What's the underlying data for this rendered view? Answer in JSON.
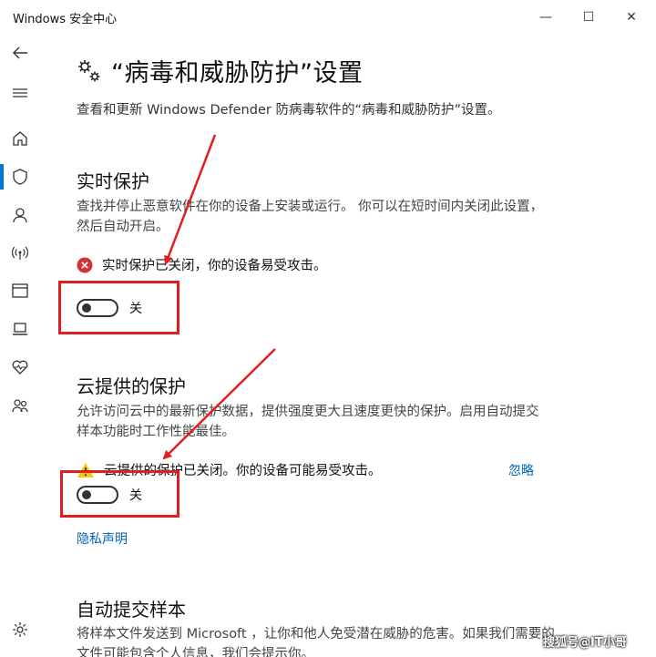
{
  "window": {
    "title": "Windows 安全中心",
    "minimize_glyph": "—",
    "maximize_glyph": "☐",
    "close_glyph": "✕"
  },
  "sidebar": {
    "items": [
      {
        "icon": "back-arrow-icon"
      },
      {
        "icon": "hamburger-menu-icon"
      },
      {
        "icon": "home-icon"
      },
      {
        "icon": "shield-icon",
        "active": true
      },
      {
        "icon": "person-icon"
      },
      {
        "icon": "wifi-antenna-icon"
      },
      {
        "icon": "browser-window-icon"
      },
      {
        "icon": "laptop-icon"
      },
      {
        "icon": "heart-pulse-icon"
      },
      {
        "icon": "family-icon"
      },
      {
        "icon": "gear-icon"
      }
    ],
    "accent_color": "#0078d7"
  },
  "page": {
    "title": "“病毒和威胁防护”设置",
    "subtitle": "查看和更新 Windows Defender 防病毒软件的“病毒和威胁防护”设置。"
  },
  "realtime": {
    "title": "实时保护",
    "desc": "查找并停止恶意软件在你的设备上安装或运行。 你可以在短时间内关闭此设置，然后自动开启。",
    "status": "实时保护已关闭，你的设备易受攻击。",
    "toggle_label": "关",
    "toggle_on": false
  },
  "cloud": {
    "title": "云提供的保护",
    "desc": "允许访问云中的最新保护数据，提供强度更大且速度更快的保护。启用自动提交样本功能时工作性能最佳。",
    "status": "云提供的保护已关闭。你的设备可能易受攻击。",
    "dismiss_link": "忽略",
    "toggle_label": "关",
    "toggle_on": false
  },
  "privacy_link": "隐私声明",
  "autosubmit": {
    "title": "自动提交样本",
    "desc": "将样本文件发送到 Microsoft ，让你和他人免受潜在威胁的危害。如果我们需要的文件可能包含个人信息，我们会提示你。"
  },
  "colors": {
    "error": "#d13438",
    "warning": "#f2c811",
    "link": "#0063b1",
    "annotation": "#e02020"
  },
  "watermark": "搜狐号@IT小哥"
}
